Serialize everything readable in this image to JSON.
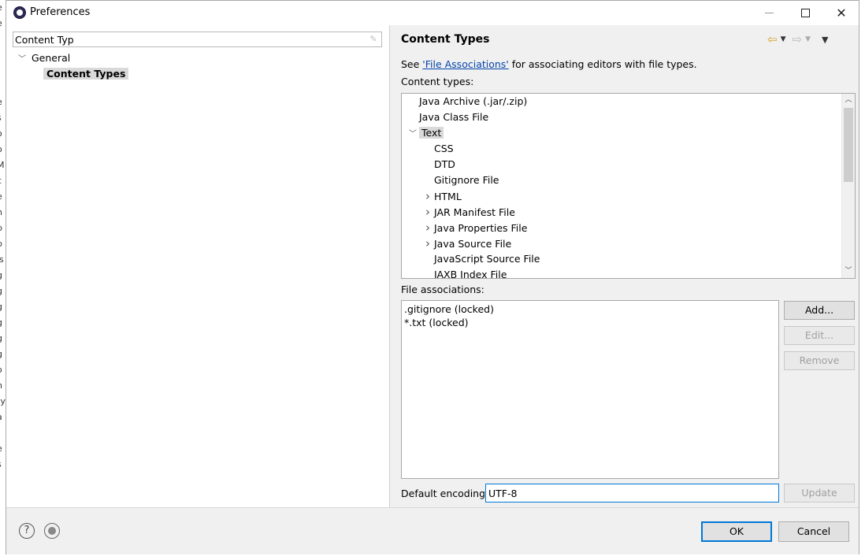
{
  "background_window": {
    "fragments": [
      "e",
      "e",
      "",
      "i",
      "t",
      "",
      "e",
      "s",
      "o",
      "o",
      "M",
      "c",
      "e",
      "h",
      "p",
      "p",
      "is",
      "g",
      "g",
      "g",
      "g",
      "g",
      "g",
      "o",
      "n",
      "ty",
      "a",
      "",
      "e",
      "s"
    ]
  },
  "window": {
    "title": "Preferences",
    "icon": "eclipse-icon"
  },
  "left": {
    "filter_value": "Content Typ",
    "tree": [
      {
        "label": "General",
        "expanded": true
      },
      {
        "label": "Content Types",
        "selected": true
      }
    ]
  },
  "right": {
    "page_title": "Content Types",
    "desc_prefix": "See ",
    "desc_link": "'File Associations'",
    "desc_suffix": " for associating editors with file types.",
    "content_types_label": "Content types:",
    "content_types": [
      {
        "label": "Java Archive (.jar/.zip)",
        "level": 0,
        "toggle": "none"
      },
      {
        "label": "Java Class File",
        "level": 0,
        "toggle": "none"
      },
      {
        "label": "Text",
        "level": 0,
        "toggle": "expanded",
        "selected": true
      },
      {
        "label": "CSS",
        "level": 1,
        "toggle": "none"
      },
      {
        "label": "DTD",
        "level": 1,
        "toggle": "none"
      },
      {
        "label": "Gitignore File",
        "level": 1,
        "toggle": "none"
      },
      {
        "label": "HTML",
        "level": 1,
        "toggle": "collapsed"
      },
      {
        "label": "JAR Manifest File",
        "level": 1,
        "toggle": "collapsed"
      },
      {
        "label": "Java Properties File",
        "level": 1,
        "toggle": "collapsed"
      },
      {
        "label": "Java Source File",
        "level": 1,
        "toggle": "collapsed"
      },
      {
        "label": "JavaScript Source File",
        "level": 1,
        "toggle": "none"
      },
      {
        "label": "JAXB Index File",
        "level": 1,
        "toggle": "none"
      }
    ],
    "file_assoc_label": "File associations:",
    "file_associations": [
      ".gitignore (locked)",
      "*.txt (locked)"
    ],
    "buttons": {
      "add": "Add...",
      "edit": "Edit...",
      "remove": "Remove",
      "update": "Update"
    },
    "default_encoding_label": "Default encoding:",
    "default_encoding_value": "UTF-8"
  },
  "footer": {
    "ok": "OK",
    "cancel": "Cancel",
    "help_glyph": "?"
  }
}
